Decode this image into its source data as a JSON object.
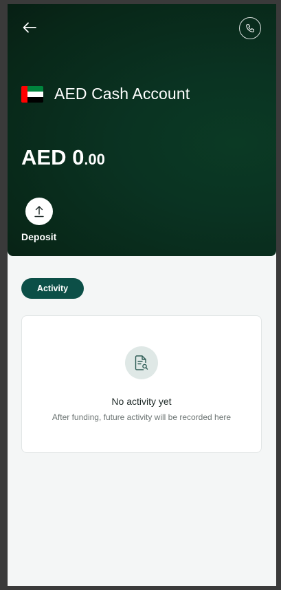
{
  "header": {
    "back_icon": "arrow-left-icon",
    "call_icon": "phone-icon"
  },
  "account": {
    "flag": "uae-flag",
    "title": "AED Cash Account",
    "balance_major": "AED 0",
    "balance_minor": ".00"
  },
  "actions": {
    "deposit_label": "Deposit",
    "deposit_icon": "upload-icon"
  },
  "tabs": [
    {
      "label": "Activity",
      "selected": true
    }
  ],
  "activity": {
    "empty_icon": "document-search-icon",
    "empty_title": "No activity yet",
    "empty_subtitle": "After funding, future activity will be recorded here"
  },
  "colors": {
    "hero_bg": "#082718",
    "accent": "#0c4f47",
    "page_bg": "#f4f6f6",
    "empty_icon_bg": "#dfe8e6"
  }
}
